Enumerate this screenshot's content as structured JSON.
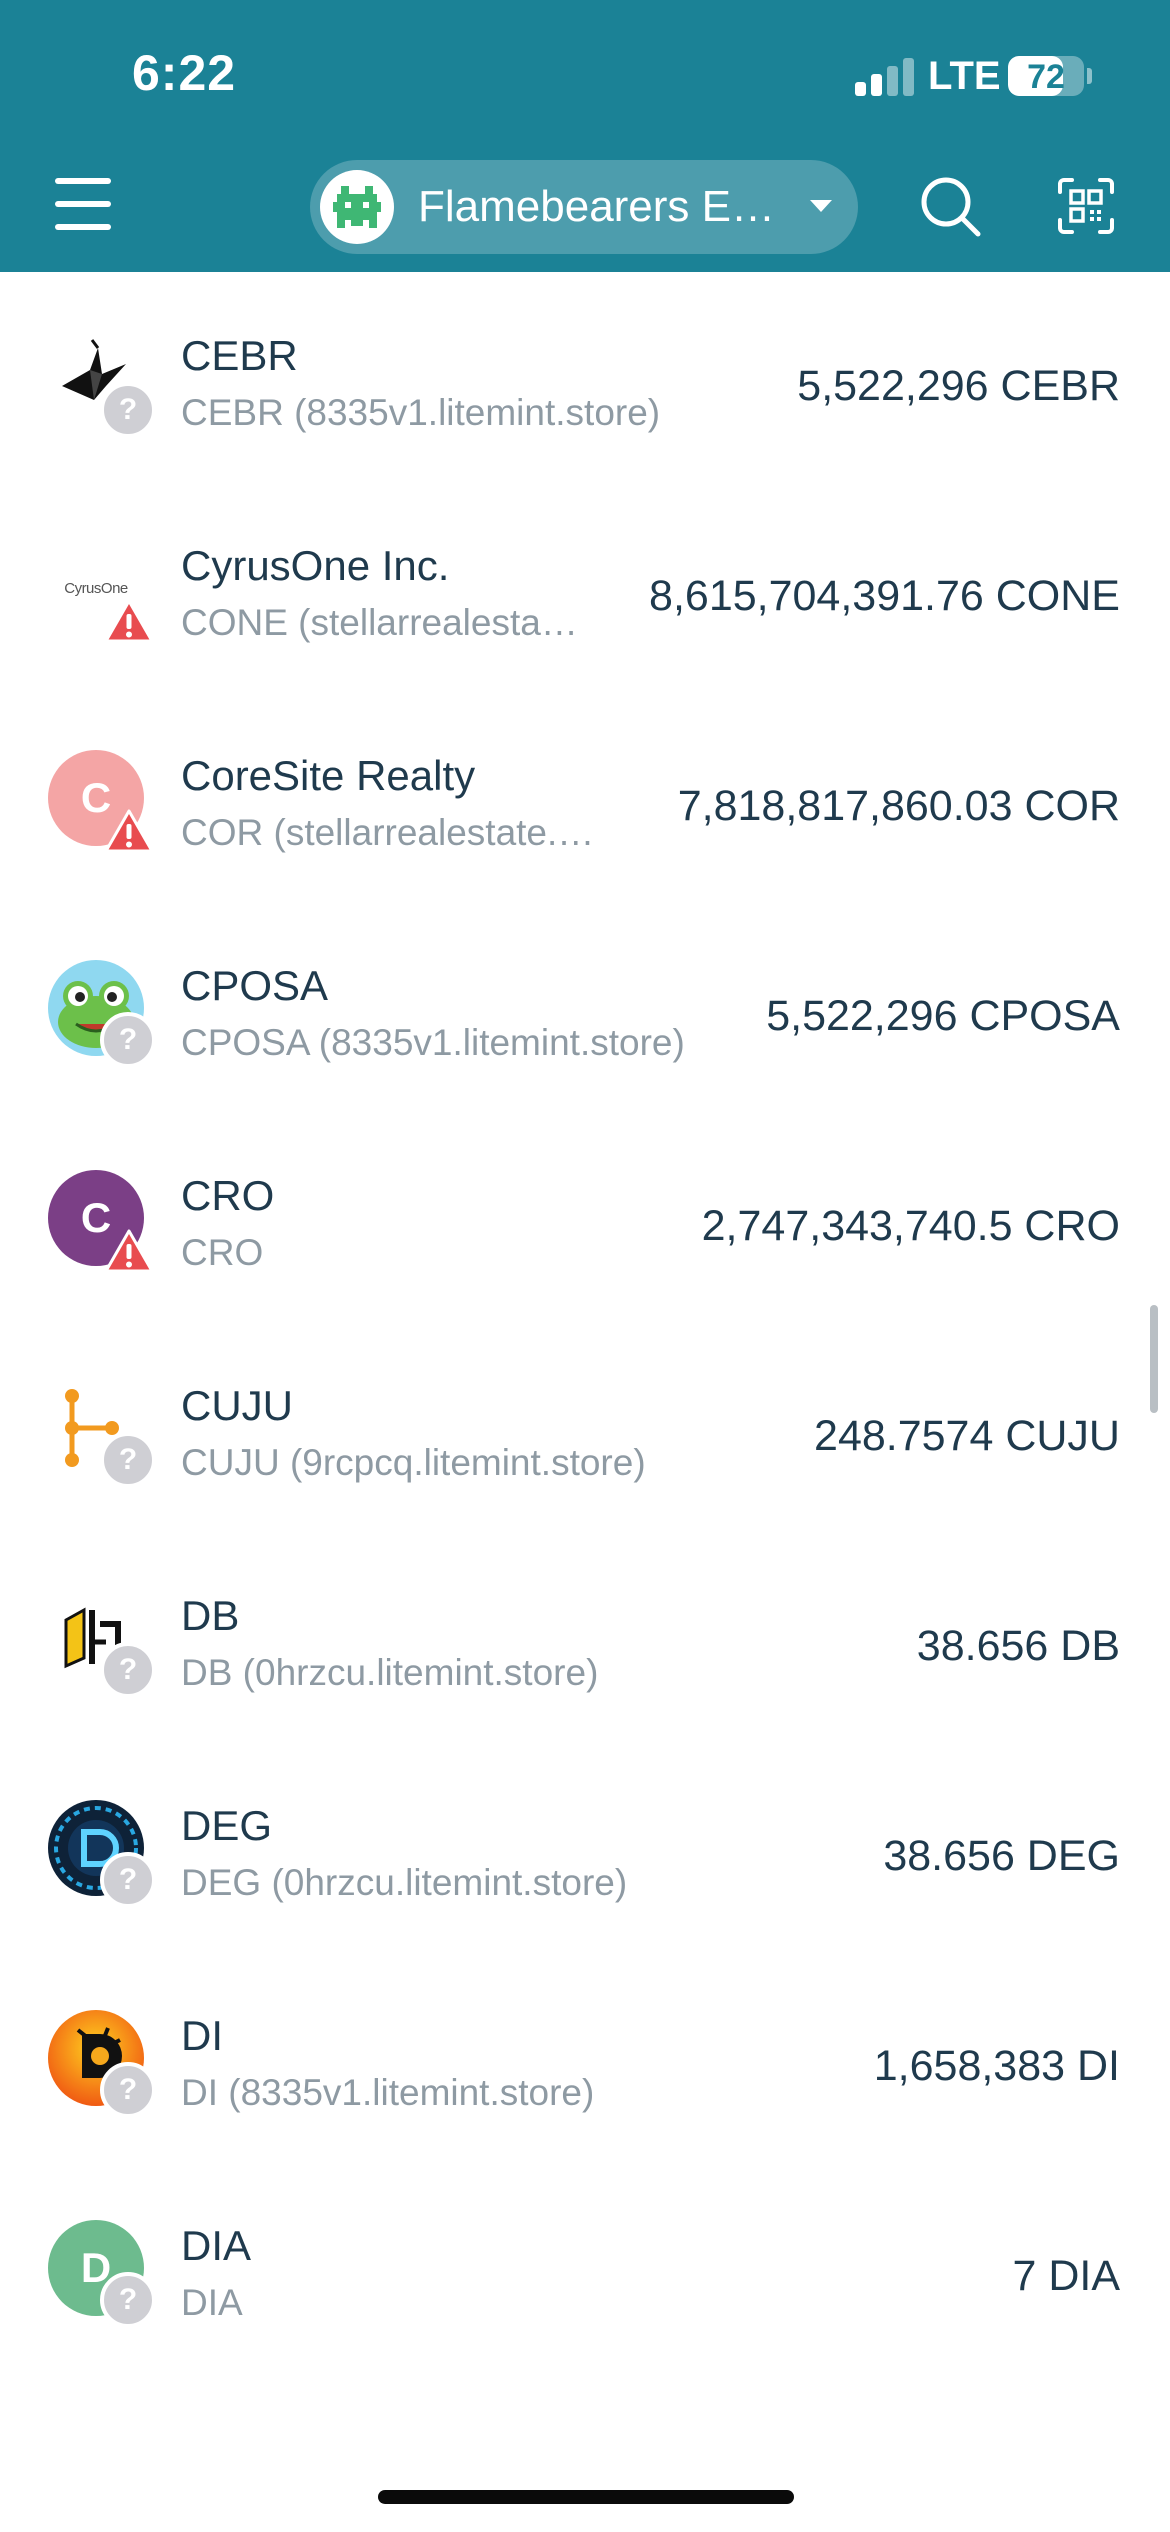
{
  "status_bar": {
    "time": "6:22",
    "network": "LTE",
    "battery": "72",
    "battery_level": 0.72
  },
  "header": {
    "wallet_name": "Flamebearers E…",
    "menu_icon": "hamburger-menu-icon",
    "search_icon": "search-icon",
    "scan_icon": "qr-scan-icon",
    "accent_color": "#1b8296"
  },
  "assets": [
    {
      "code": "CEBR",
      "subtitle": "CEBR (8335v1.litemint.store)",
      "balance": "5,522,296 CEBR",
      "icon": "origami-crane-icon",
      "badge": "unknown"
    },
    {
      "code": "CyrusOne Inc.",
      "subtitle": "CONE (stellarrealesta…",
      "balance": "8,615,704,391.76 CONE",
      "icon": "cyrusone-logo-icon",
      "icon_text": "CyrusOne",
      "badge": "warning"
    },
    {
      "code": "CoreSite Realty",
      "subtitle": "COR (stellarrealestate.…",
      "balance": "7,818,817,860.03 COR",
      "icon": "letter-avatar",
      "avatar_letter": "C",
      "avatar_color": "#f4a5a5",
      "badge": "warning"
    },
    {
      "code": "CPOSA",
      "subtitle": "CPOSA (8335v1.litemint.store)",
      "balance": "5,522,296 CPOSA",
      "icon": "frog-icon",
      "badge": "unknown"
    },
    {
      "code": "CRO",
      "subtitle": "CRO",
      "balance": "2,747,343,740.5 CRO",
      "icon": "letter-avatar",
      "avatar_letter": "C",
      "avatar_color": "#7b3f86",
      "badge": "warning"
    },
    {
      "code": "CUJU",
      "subtitle": "CUJU (9rcpcq.litemint.store)",
      "balance": "248.7574 CUJU",
      "icon": "node-graph-icon",
      "badge": "unknown"
    },
    {
      "code": "DB",
      "subtitle": "DB (0hrzcu.litemint.store)",
      "balance": "38.656 DB",
      "icon": "db-logo-icon",
      "badge": "unknown"
    },
    {
      "code": "DEG",
      "subtitle": "DEG (0hrzcu.litemint.store)",
      "balance": "38.656 DEG",
      "icon": "deg-logo-icon",
      "badge": "unknown"
    },
    {
      "code": "DI",
      "subtitle": "DI (8335v1.litemint.store)",
      "balance": "1,658,383 DI",
      "icon": "di-logo-icon",
      "badge": "unknown"
    },
    {
      "code": "DIA",
      "subtitle": "DIA",
      "balance": "7 DIA",
      "icon": "letter-avatar",
      "avatar_letter": "D",
      "avatar_color": "#6dbb8e",
      "badge": "unknown"
    }
  ]
}
